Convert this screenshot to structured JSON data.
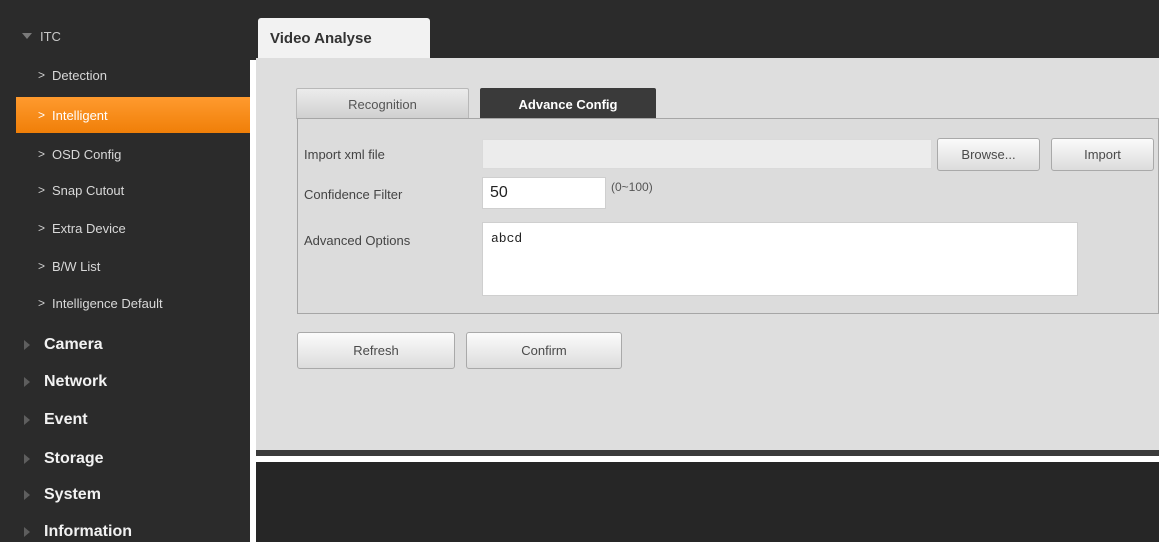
{
  "sidebar": {
    "section": "ITC",
    "sub_items": [
      {
        "label": "Detection"
      },
      {
        "label": "Intelligent"
      },
      {
        "label": "OSD Config"
      },
      {
        "label": "Snap Cutout"
      },
      {
        "label": "Extra Device"
      },
      {
        "label": "B/W List"
      },
      {
        "label": "Intelligence Default"
      }
    ],
    "main_items": [
      {
        "label": "Camera"
      },
      {
        "label": "Network"
      },
      {
        "label": "Event"
      },
      {
        "label": "Storage"
      },
      {
        "label": "System"
      },
      {
        "label": "Information"
      }
    ],
    "active_item": "Intelligent",
    "accent_color": "#f7891a"
  },
  "page": {
    "tab_title": "Video Analyse"
  },
  "tabs": [
    {
      "label": "Recognition",
      "selected": false
    },
    {
      "label": "Advance Config",
      "selected": true
    }
  ],
  "form": {
    "import_label": "Import xml file",
    "import_value": "",
    "browse_label": "Browse...",
    "import_button_label": "Import",
    "confidence_label": "Confidence Filter",
    "confidence_value": "50",
    "confidence_range": "(0~100)",
    "advanced_label": "Advanced Options",
    "advanced_value": "abcd"
  },
  "actions": {
    "refresh_label": "Refresh",
    "confirm_label": "Confirm"
  }
}
